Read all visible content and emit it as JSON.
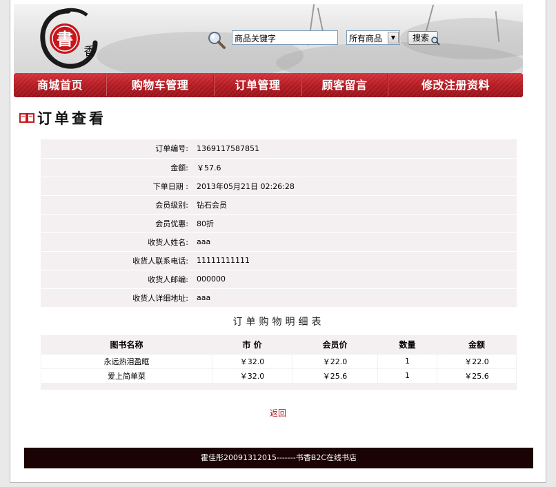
{
  "search": {
    "value": "商品关键字",
    "category": "所有商品",
    "button_label": "搜索"
  },
  "logo": {
    "char_big": "書",
    "char_small": "香"
  },
  "nav": {
    "items": [
      "商城首页",
      "购物车管理",
      "订单管理",
      "顾客留言",
      "修改注册资料"
    ]
  },
  "page_title": "订单查看",
  "order": {
    "rows": [
      {
        "label": "订单编号:",
        "value": "1369117587851"
      },
      {
        "label": "金额:",
        "value": "￥57.6"
      },
      {
        "label": "下单日期 :",
        "value": "2013年05月21日 02:26:28"
      },
      {
        "label": "会员级别:",
        "value": "钻石会员"
      },
      {
        "label": "会员优惠:",
        "value": "80折"
      },
      {
        "label": "收货人姓名:",
        "value": "aaa"
      },
      {
        "label": "收货人联系电话:",
        "value": "11111111111"
      },
      {
        "label": "收货人邮编:",
        "value": "000000"
      },
      {
        "label": "收货人详细地址:",
        "value": "aaa"
      }
    ]
  },
  "detail_title": "订单购物明细表",
  "items": {
    "headers": [
      "图书名称",
      "市 价",
      "会员价",
      "数量",
      "金额"
    ],
    "rows": [
      [
        "永远热泪盈眶",
        "￥32.0",
        "￥22.0",
        "1",
        "￥22.0"
      ],
      [
        "爱上简单菜",
        "￥32.0",
        "￥25.6",
        "1",
        "￥25.6"
      ]
    ]
  },
  "back_label": "返回",
  "footer_text": "霍佳彤20091312015-------书香B2C在线书店",
  "colors": {
    "nav_red": "#b41b22",
    "footer_bg": "#1c0303",
    "table_bg": "#f4eff1",
    "link_red": "#b0222b"
  }
}
